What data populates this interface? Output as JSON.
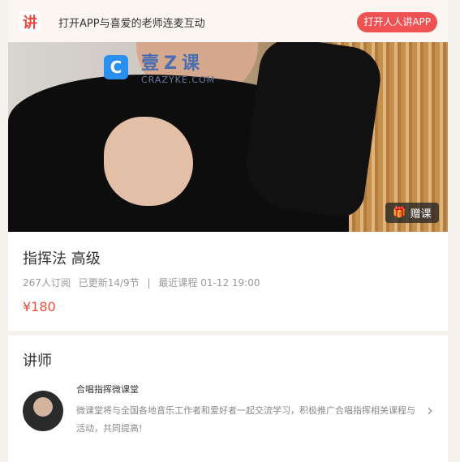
{
  "banner": {
    "logo_char": "讲",
    "text": "打开APP与喜爱的老师连麦互动",
    "open_button": "打开人人讲APP"
  },
  "hero": {
    "watermark_title": "壹Z课",
    "watermark_sub": "CRAZYKE.COM",
    "watermark_icon": "C",
    "gift_icon": "gift-icon",
    "gift_label": "赠课"
  },
  "course": {
    "title": "指挥法 高级",
    "subscribers": "267人订阅",
    "updated": "已更新14/9节",
    "separator": "|",
    "latest": "最近课程 01-12 19:00",
    "price": "¥180"
  },
  "teacher_section": {
    "title": "讲师",
    "name": "合唱指挥微课堂",
    "description": "微课堂将与全国各地音乐工作者和爱好者一起交流学习，积极推广合唱指挥相关课程与活动，共同提高!",
    "chevron": "›"
  },
  "colors": {
    "accent": "#ee5252",
    "price": "#e84c3d",
    "background": "#f5f1ec"
  }
}
